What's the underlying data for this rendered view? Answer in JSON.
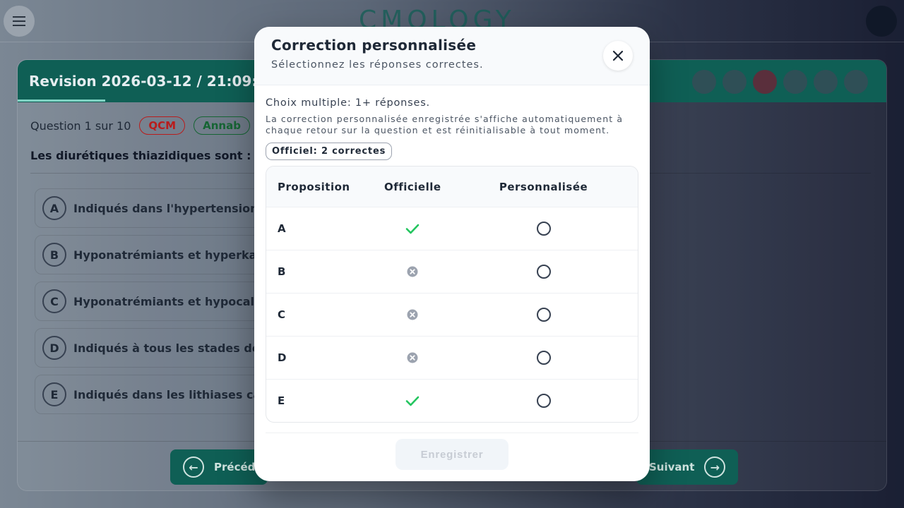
{
  "background": {
    "logo": "CMOLOGY",
    "revision_title": "Revision 2026-03-12 / 21:09:",
    "question_counter": "Question 1 sur 10",
    "badges": [
      "QCM",
      "Annab"
    ],
    "question_text": "Les diurétiques thiazidiques sont :",
    "options": [
      {
        "letter": "A",
        "text": "Indiqués dans l'hypertension a"
      },
      {
        "letter": "B",
        "text": "Hyponatrémiants et hyperkali"
      },
      {
        "letter": "C",
        "text": "Hyponatrémiants et hypocalce"
      },
      {
        "letter": "D",
        "text": "Indiqués à tous les stades de"
      },
      {
        "letter": "E",
        "text": "Indiqués dans les lithiases ca"
      }
    ],
    "prev_label": "Précéd",
    "next_label": "Suivant"
  },
  "modal": {
    "title": "Correction personnalisée",
    "subtitle": "Sélectionnez les réponses correctes.",
    "choice_info": "Choix multiple: 1+ réponses.",
    "note": "La correction personnalisée enregistrée s'affiche automatiquement à chaque retour sur la question et est réinitialisable à tout moment.",
    "official_pill": "Officiel: 2 correctes",
    "columns": [
      "Proposition",
      "Officielle",
      "Personnalisée"
    ],
    "rows": [
      {
        "letter": "A",
        "official": "correct"
      },
      {
        "letter": "B",
        "official": "incorrect"
      },
      {
        "letter": "C",
        "official": "incorrect"
      },
      {
        "letter": "D",
        "official": "incorrect"
      },
      {
        "letter": "E",
        "official": "correct"
      }
    ],
    "save_label": "Enregistrer"
  },
  "colors": {
    "accent": "#0f5f55",
    "check_green": "#22c55e",
    "cross_gray": "#9ca3af"
  }
}
